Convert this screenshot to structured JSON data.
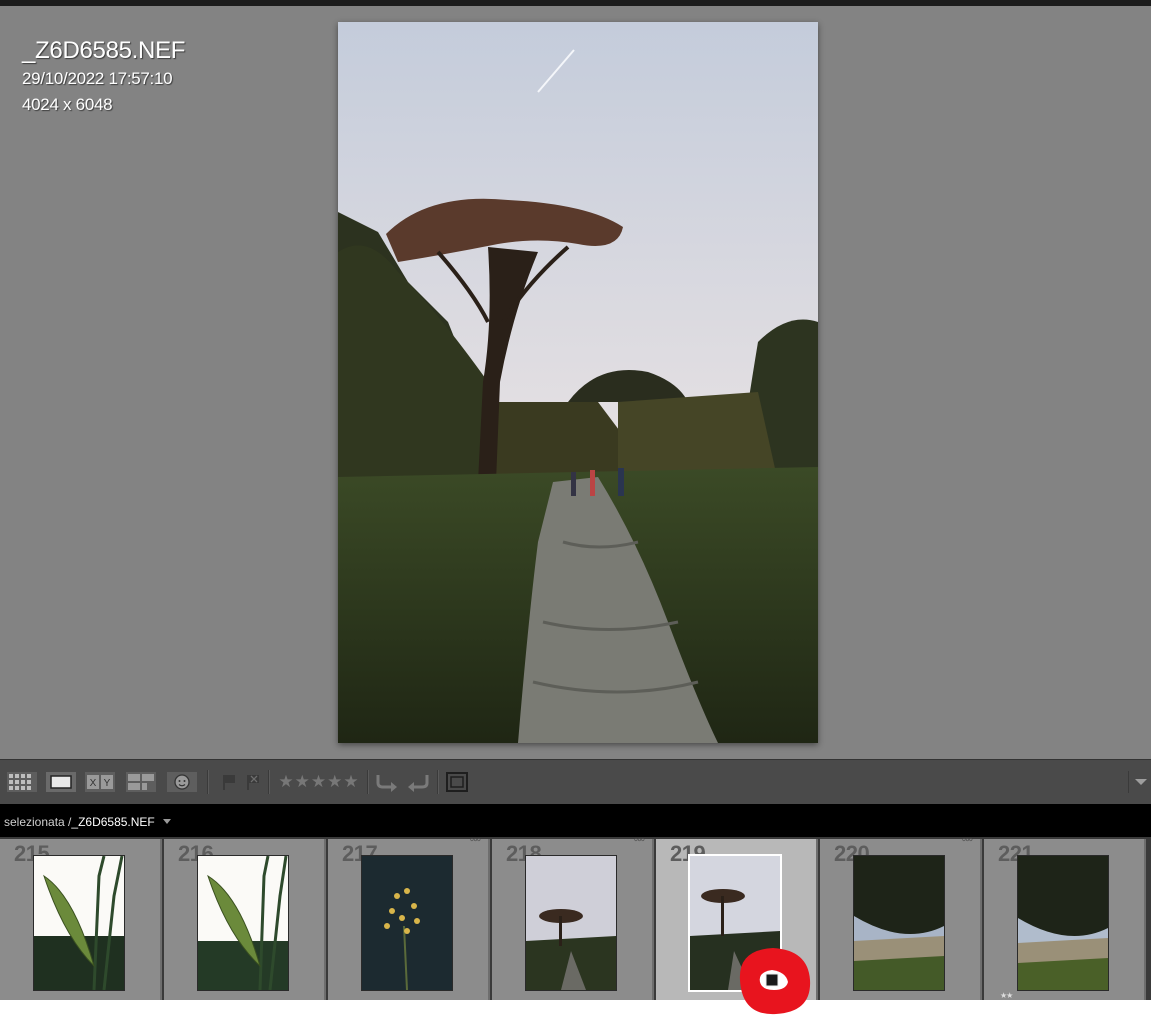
{
  "photo_info": {
    "filename": "_Z6D6585.NEF",
    "datetime": "29/10/2022 17:57:10",
    "dimensions": "4024 x 6048"
  },
  "toolbar": {
    "buttons": [
      {
        "name": "grid-view-button",
        "icon": "grid-icon"
      },
      {
        "name": "loupe-view-button",
        "icon": "loupe-icon"
      },
      {
        "name": "compare-view-button",
        "icon": "compare-xy-icon",
        "label": "XY"
      },
      {
        "name": "survey-view-button",
        "icon": "survey-icon"
      },
      {
        "name": "people-view-button",
        "icon": "face-icon"
      },
      {
        "name": "flag-pick-button",
        "icon": "flag-icon"
      },
      {
        "name": "flag-reject-button",
        "icon": "reject-flag-icon"
      },
      {
        "name": "rotate-left-button",
        "icon": "rotate-left-icon"
      },
      {
        "name": "rotate-right-button",
        "icon": "rotate-right-icon"
      },
      {
        "name": "crop-overlay-button",
        "icon": "crop-frame-icon"
      }
    ],
    "rating_stars": "★★★★★"
  },
  "pathbar": {
    "prefix": "selezionata /",
    "filename": "_Z6D6585.NEF",
    "dropdown_icon": "triangle-down-icon"
  },
  "filmstrip": {
    "cells": [
      {
        "number": "215",
        "selected": false,
        "badge": ""
      },
      {
        "number": "216",
        "selected": false,
        "badge": ""
      },
      {
        "number": "217",
        "selected": false,
        "badge": "°°°"
      },
      {
        "number": "218",
        "selected": false,
        "badge": "°°°"
      },
      {
        "number": "219",
        "selected": true,
        "badge": ""
      },
      {
        "number": "220",
        "selected": false,
        "badge": "°°°"
      },
      {
        "number": "221",
        "selected": false,
        "badge": "",
        "stars": "★★"
      }
    ]
  },
  "annotation": {
    "color": "#e8141e",
    "marks": "develop-adjusted-badge"
  },
  "colors": {
    "loupe_bg": "#838383",
    "toolbar_bg": "#4a4a4a",
    "filmstrip_cell": "#8c8c8c",
    "selected_cell": "#b8b8b8"
  }
}
